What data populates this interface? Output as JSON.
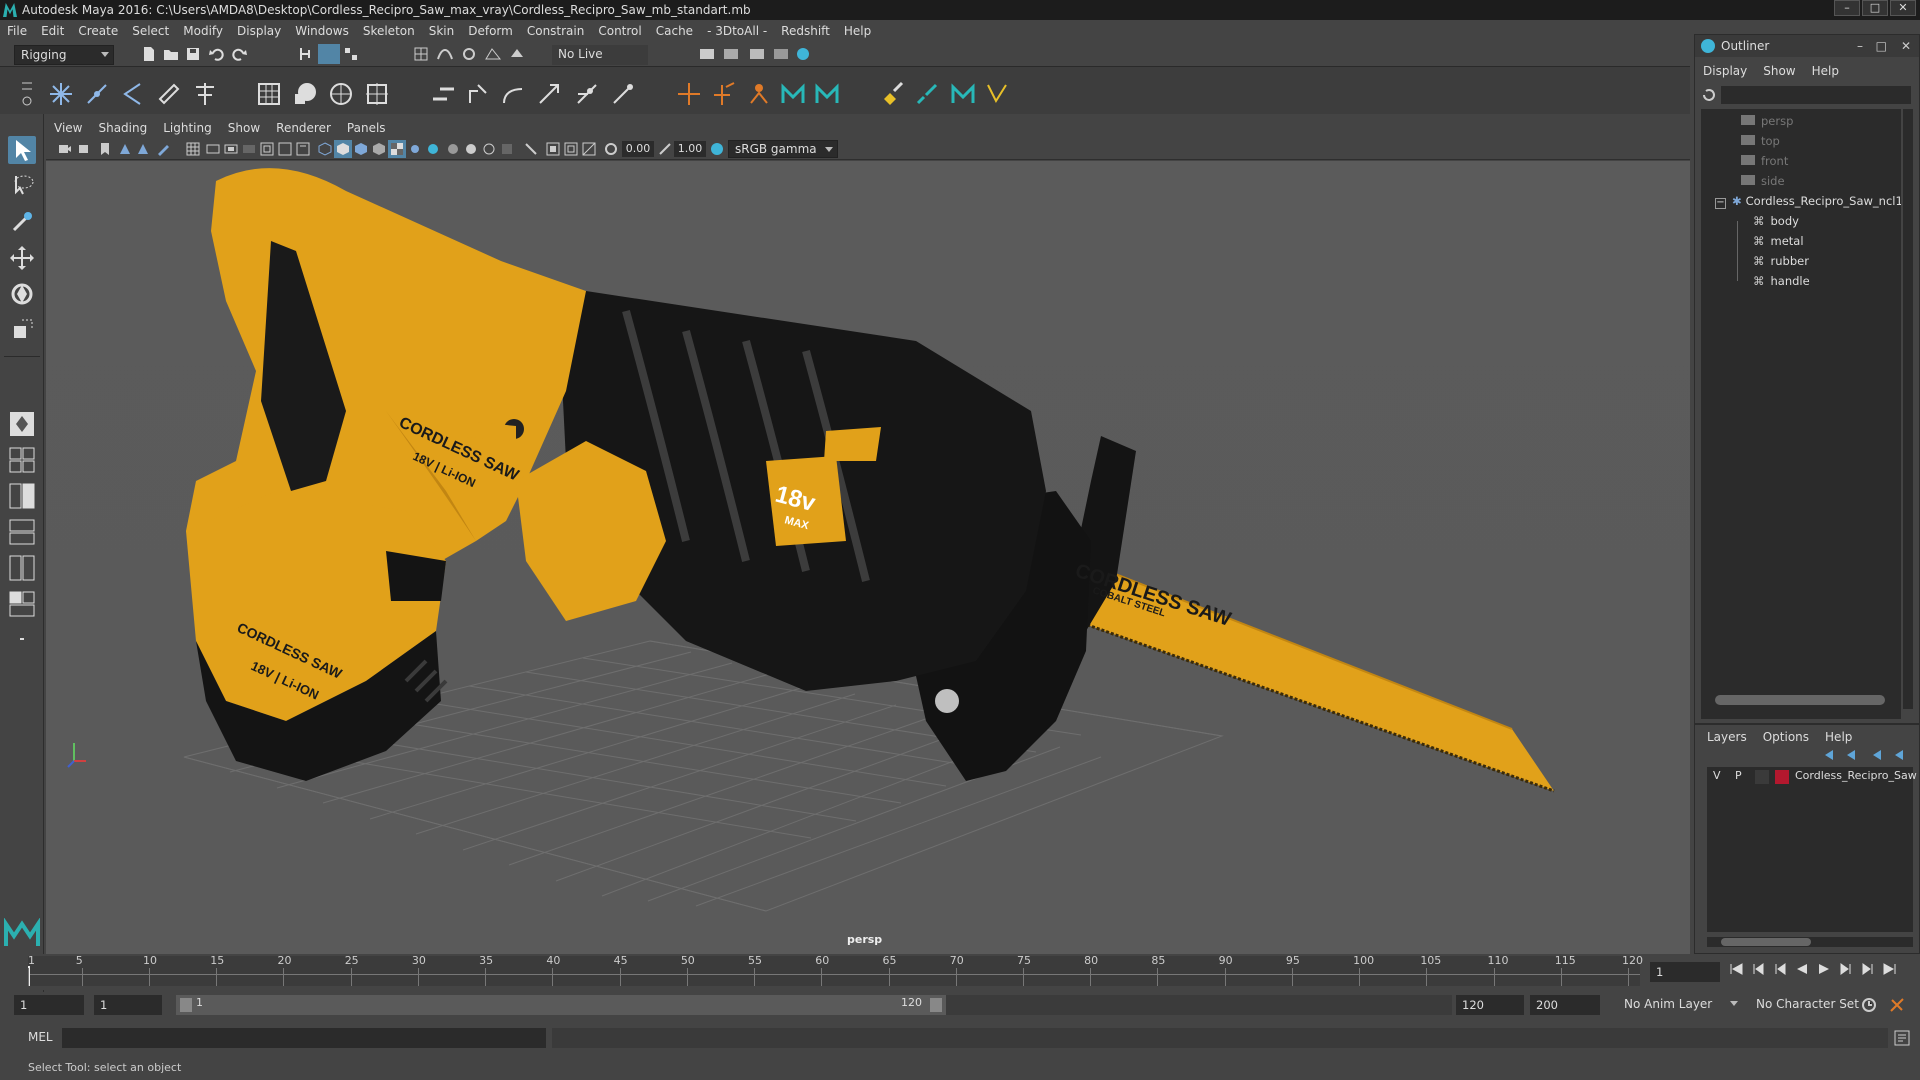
{
  "titlebar": {
    "title": "Autodesk Maya 2016: C:\\Users\\AMDA8\\Desktop\\Cordless_Recipro_Saw_max_vray\\Cordless_Recipro_Saw_mb_standart.mb",
    "minimize": "–",
    "maximize": "□",
    "close": "✕"
  },
  "menubar": {
    "items": [
      "File",
      "Edit",
      "Create",
      "Select",
      "Modify",
      "Display",
      "Windows",
      "Skeleton",
      "Skin",
      "Deform",
      "Constrain",
      "Control",
      "Cache",
      "- 3DtoAll -",
      "Redshift",
      "Help"
    ]
  },
  "statusline": {
    "menu_set": "Rigging",
    "live_surface": "No Live Surface"
  },
  "viewport": {
    "menu": [
      "View",
      "Shading",
      "Lighting",
      "Show",
      "Renderer",
      "Panels"
    ],
    "near_value": "0.00",
    "gamma_value": "1.00",
    "color_space": "sRGB gamma",
    "camera_label": "persp",
    "model": {
      "battery_brand": "CORDLESS SAW",
      "battery_spec": "18V | Li-ION",
      "body_brand": "CORDLESS SAW",
      "body_spec": "18V | Li-ION",
      "voltage_badge": "18v",
      "voltage_sub": "MAX",
      "blade_brand": "CORDLESS SAW",
      "blade_sub": "COBALT STEEL"
    },
    "colors": {
      "body_yellow": "#E1A11A",
      "rubber_black": "#111111",
      "background": "#5A5A5A",
      "grid": "#6E6E6E"
    }
  },
  "outliner": {
    "title": "Outliner",
    "menu": [
      "Display",
      "Show",
      "Help"
    ],
    "cameras": [
      "persp",
      "top",
      "front",
      "side"
    ],
    "root": "Cordless_Recipro_Saw_ncl1",
    "children": [
      "body",
      "metal",
      "rubber",
      "handle"
    ]
  },
  "layers": {
    "menu": [
      "Layers",
      "Options",
      "Help"
    ],
    "visible_flag": "V",
    "playback_flag": "P",
    "layer_name": "Cordless_Recipro_Saw",
    "layer_color": "#B3182E"
  },
  "timeline": {
    "ticks": [
      "1",
      "5",
      "10",
      "15",
      "20",
      "25",
      "30",
      "35",
      "40",
      "45",
      "50",
      "55",
      "60",
      "65",
      "70",
      "75",
      "80",
      "85",
      "90",
      "95",
      "100",
      "105",
      "110",
      "115",
      "120"
    ],
    "current_frame": "1",
    "range_start": "1",
    "playback_start": "1",
    "range_slider_start": "1",
    "range_slider_end": "120",
    "playback_end": "120",
    "range_end": "200",
    "anim_layer": "No Anim Layer",
    "character_set": "No Character Set"
  },
  "cmdline": {
    "label": "MEL"
  },
  "helpline": {
    "text": "Select Tool: select an object"
  }
}
